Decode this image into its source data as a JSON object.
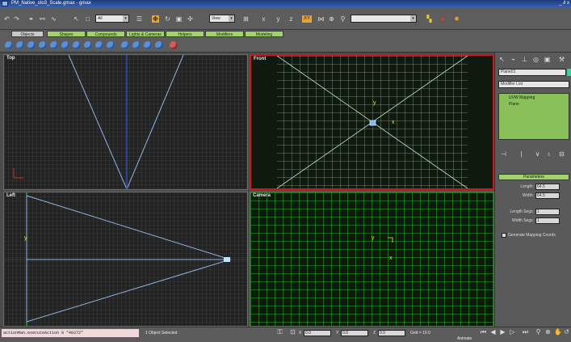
{
  "window": {
    "title": "PM_Native_sto3_Scale.gmax - gmax",
    "controls": "_ ∂ x"
  },
  "toolbar": {
    "selection_filter": "All",
    "ref_coord": "View",
    "named_selection": ""
  },
  "command_tabs": [
    {
      "label": "Objects",
      "active": true
    },
    {
      "label": "Shapes",
      "active": false
    },
    {
      "label": "Compounds",
      "active": false
    },
    {
      "label": "Lights & Cameras",
      "active": false
    },
    {
      "label": "Helpers",
      "active": false
    },
    {
      "label": "Modifiers",
      "active": false
    },
    {
      "label": "Modeling",
      "active": false
    }
  ],
  "viewports": {
    "top": "Top",
    "front": "Front",
    "left": "Left",
    "camera": "Camera"
  },
  "panel": {
    "object_name": "Plane01",
    "modifier_list": "Modifier List",
    "stack": [
      "UVW Mapping",
      "Plane"
    ],
    "parameters_title": "Parameters",
    "params": [
      {
        "label": "Length:",
        "value": "64.5"
      },
      {
        "label": "Width:",
        "value": "64.5"
      },
      {
        "label": "Length Segs:",
        "value": "1"
      },
      {
        "label": "Width Segs:",
        "value": "1"
      }
    ],
    "gen_mapping": "Generate Mapping Coords"
  },
  "status": {
    "maxscript": "actionMan.executeAction 0 \"40372\"",
    "selected": "1 Object Selected",
    "x_label": "X",
    "x": "0.0",
    "y_label": "Y",
    "y": "0.0",
    "z_label": "Z",
    "z": "0.0",
    "grid": "Grid = 10.0",
    "animate": "Animate"
  },
  "colors": {
    "viewport_bg": "#232323",
    "grid_green": "#2ee02e",
    "active_border": "#d01818",
    "tab_green": "#9ed46a",
    "highlight": "#e8a03a"
  }
}
